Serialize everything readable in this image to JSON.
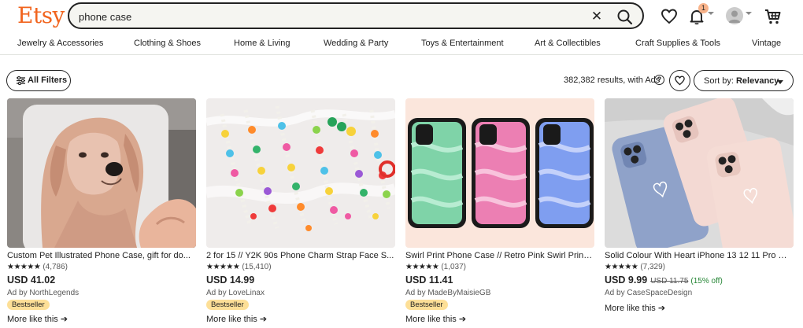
{
  "header": {
    "logo": "Etsy",
    "search_value": "phone case",
    "notification_count": "1"
  },
  "categories": [
    "Jewelry & Accessories",
    "Clothing & Shoes",
    "Home & Living",
    "Wedding & Party",
    "Toys & Entertainment",
    "Art & Collectibles",
    "Craft Supplies & Tools",
    "Vintage"
  ],
  "toolbar": {
    "filters_label": "All Filters",
    "results_text": "382,382 results, with Ads",
    "help_glyph": "?",
    "sort_prefix": "Sort by:",
    "sort_value": "Relevancy"
  },
  "listings": [
    {
      "title": "Custom Pet Illustrated Phone Case, gift for do...",
      "stars": "★★★★★",
      "reviews": "(4,786)",
      "price": "USD 41.02",
      "seller": "Ad by NorthLegends",
      "badge": "Bestseller",
      "more": "More like this"
    },
    {
      "title": "2 for 15 // Y2K 90s Phone Charm Strap Face S...",
      "stars": "★★★★★",
      "reviews": "(15,410)",
      "price": "USD 14.99",
      "seller": "Ad by LoveLinax",
      "badge": "Bestseller",
      "more": "More like this"
    },
    {
      "title": "Swirl Print Phone Case // Retro Pink Swirl Print,...",
      "stars": "★★★★★",
      "reviews": "(1,037)",
      "price": "USD 11.41",
      "seller": "Ad by MadeByMaisieGB",
      "badge": "Bestseller",
      "more": "More like this"
    },
    {
      "title": "Solid Colour With Heart iPhone 13 12 11 Pro Ma...",
      "stars": "★★★★★",
      "reviews": "(7,329)",
      "price": "USD 9.99",
      "old_price": "USD 11.75",
      "discount": "(15% off)",
      "seller": "Ad by CaseSpaceDesign",
      "more": "More like this"
    }
  ],
  "colors": {
    "brand": "#f1641e",
    "badge": "#fddf97",
    "discount": "#258635"
  },
  "icons": [
    "search-icon",
    "close-icon",
    "heart-icon",
    "bell-icon",
    "avatar",
    "cart-icon",
    "filter-icon",
    "arrow-right-icon"
  ]
}
